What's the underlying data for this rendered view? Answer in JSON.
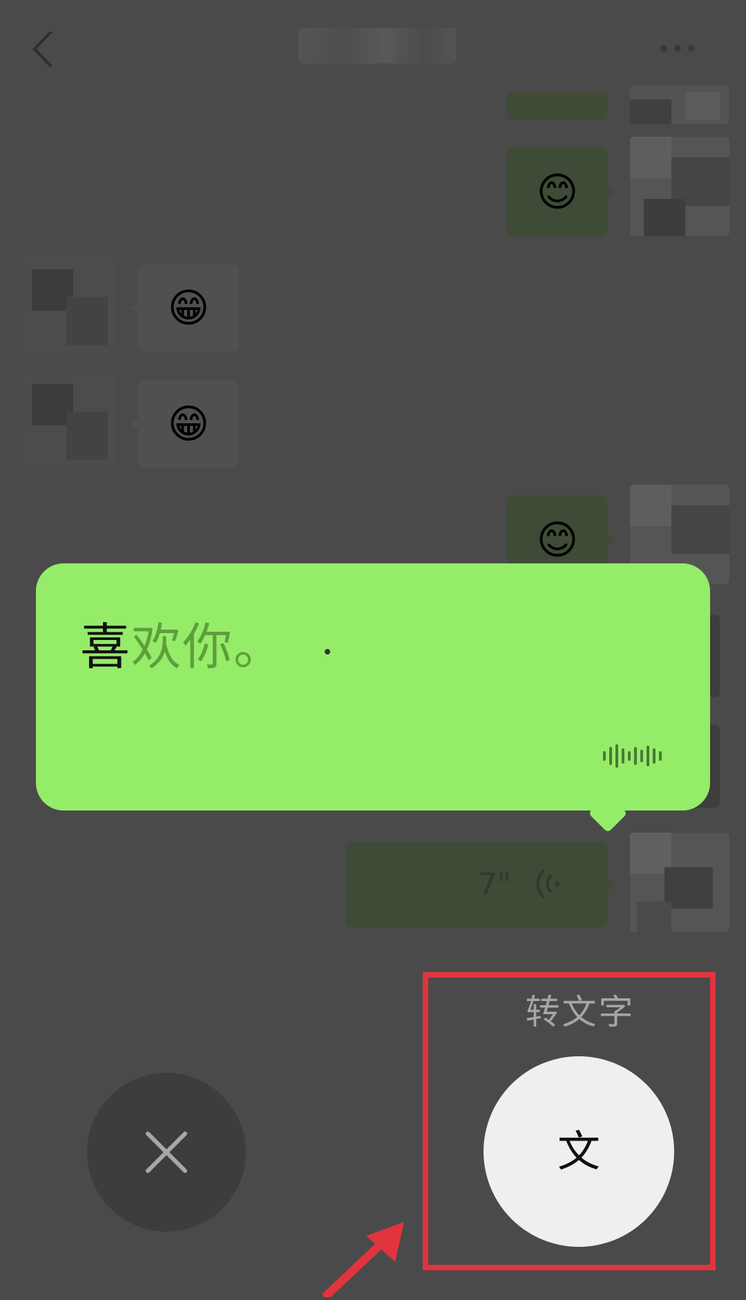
{
  "header": {
    "back_icon": "chevron-left-icon",
    "more_icon": "ellipsis-icon"
  },
  "messages": {
    "emoji_smile": "😊",
    "emoji_grin": "😁"
  },
  "voice_message": {
    "duration": "7\"",
    "icon": "voice-waves-icon"
  },
  "transcription": {
    "recognized": "喜",
    "pending": "欢你。",
    "wave_icon": "soundwave-icon"
  },
  "controls": {
    "to_text_label": "转文字",
    "to_text_glyph": "文",
    "cancel_icon": "close-icon"
  },
  "colors": {
    "bubble_green": "#95ec69",
    "highlight": "#e2343e",
    "background": "#4a4a4a"
  }
}
